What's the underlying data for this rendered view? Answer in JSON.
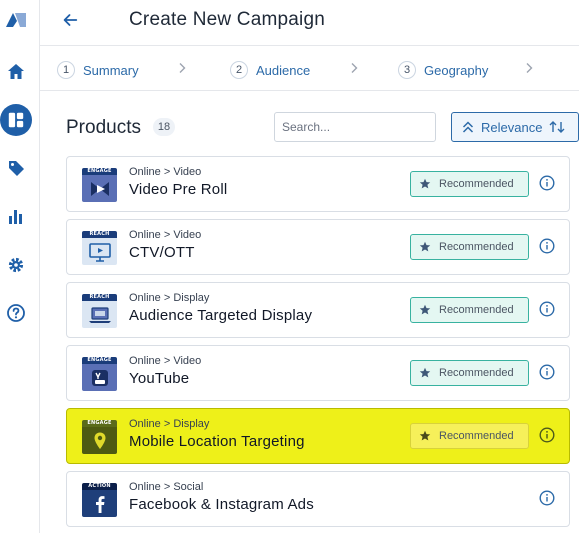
{
  "header": {
    "title": "Create New Campaign"
  },
  "steps": [
    {
      "num": "1",
      "label": "Summary"
    },
    {
      "num": "2",
      "label": "Audience"
    },
    {
      "num": "3",
      "label": "Geography"
    }
  ],
  "products": {
    "title": "Products",
    "count": "18",
    "search_placeholder": "Search...",
    "sort_label": "Relevance",
    "recommended_label": "Recommended",
    "items": [
      {
        "tag": "ENGAGE",
        "category": "Online > Video",
        "name": "Video Pre Roll",
        "recommended": true,
        "highlighted": false
      },
      {
        "tag": "REACH",
        "category": "Online > Video",
        "name": "CTV/OTT",
        "recommended": true,
        "highlighted": false
      },
      {
        "tag": "REACH",
        "category": "Online > Display",
        "name": "Audience Targeted Display",
        "recommended": true,
        "highlighted": false
      },
      {
        "tag": "ENGAGE",
        "category": "Online > Video",
        "name": "YouTube",
        "recommended": true,
        "highlighted": false
      },
      {
        "tag": "ENGAGE",
        "category": "Online > Display",
        "name": "Mobile Location Targeting",
        "recommended": true,
        "highlighted": true
      },
      {
        "tag": "ACTION",
        "category": "Online > Social",
        "name": "Facebook & Instagram Ads",
        "recommended": false,
        "highlighted": false
      }
    ]
  },
  "colors": {
    "accent": "#2c6aa8",
    "rail_icon": "#1f5fa8",
    "recommended_bg": "#e4f7f2",
    "recommended_border": "#38b2a0",
    "highlight": "#eef019"
  }
}
